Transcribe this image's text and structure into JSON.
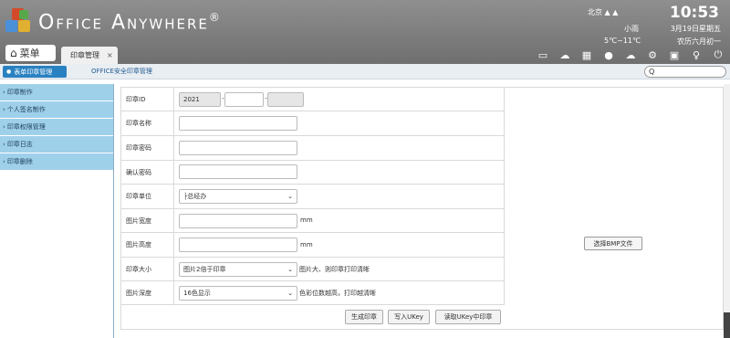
{
  "header": {
    "app_title": "Office Anywhere",
    "trademark": "®",
    "city": "北京",
    "clock": "10:53",
    "weather": "小雨",
    "date": "3月19日星期五",
    "temp": "5℃~11℃",
    "lunar": "农历六月初一",
    "menu_label": "菜单",
    "tab_label": "印章管理",
    "tab_close": "×"
  },
  "toolbar": [
    "monitor-icon",
    "cloud-up-icon",
    "grid-icon",
    "user-icon",
    "cloud-icon",
    "gear-icon",
    "shirt-icon",
    "key-icon",
    "power-icon"
  ],
  "subnav": {
    "active_label": "表单印章管理",
    "other_label": "OFFICE安全印章管理",
    "search_icon": "Q"
  },
  "sidebar": {
    "items": [
      {
        "label": "印章制作"
      },
      {
        "label": "个人签名制作"
      },
      {
        "label": "印章权限管理"
      },
      {
        "label": "印章日志"
      },
      {
        "label": "印章删除"
      }
    ]
  },
  "form": {
    "seal_id_label": "印章ID",
    "seal_id_year": "2021",
    "seal_id_sep": "-",
    "seal_name_label": "印章名称",
    "password_label": "印章密码",
    "confirm_label": "确认密码",
    "unit_label": "印章单位",
    "unit_value": "├总经办",
    "width_label": "图片宽度",
    "height_label": "图片高度",
    "unit_mm": "mm",
    "size_label": "印章大小",
    "size_value": "图片2倍于印章",
    "size_hint": "图片大、则印章打印清晰",
    "depth_label": "图片深度",
    "depth_value": "16色显示",
    "depth_hint": "色彩位数越高，打印越清晰",
    "bmp_button": "选择BMP文件",
    "generate_button": "生成印章",
    "write_button": "写入UKey",
    "read_button": "读取UKey中印章"
  },
  "colors": {
    "header_bg": "#7f7f7f",
    "sidebar_item": "#9fd0ea",
    "active_tab": "#2a81c1"
  }
}
